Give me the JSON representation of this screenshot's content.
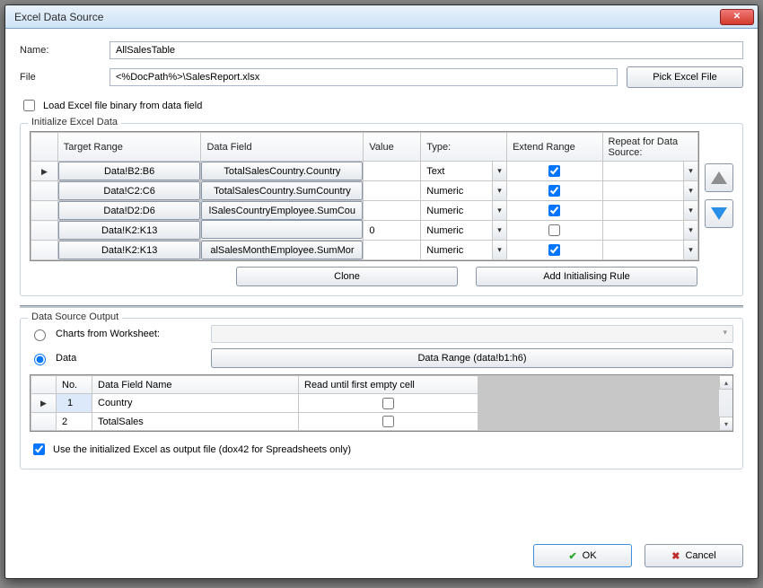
{
  "window": {
    "title": "Excel Data Source"
  },
  "form": {
    "name_label": "Name:",
    "name_value": "AllSalesTable",
    "file_label": "File",
    "file_value": "<%DocPath%>\\SalesReport.xlsx",
    "pick_file_label": "Pick Excel File",
    "load_binary_label": "Load Excel file binary from data field",
    "load_binary_checked": false
  },
  "init_group": {
    "title": "Initialize Excel Data",
    "headers": {
      "target_range": "Target Range",
      "data_field": "Data Field",
      "value": "Value",
      "type": "Type:",
      "extend_range": "Extend Range",
      "repeat": "Repeat for Data Source:"
    },
    "rows": [
      {
        "target": "Data!B2:B6",
        "field": "TotalSalesCountry.Country",
        "value": "",
        "type": "Text",
        "extend": true
      },
      {
        "target": "Data!C2:C6",
        "field": "TotalSalesCountry.SumCountry",
        "value": "",
        "type": "Numeric",
        "extend": true
      },
      {
        "target": "Data!D2:D6",
        "field": "lSalesCountryEmployee.SumCou",
        "value": "",
        "type": "Numeric",
        "extend": true
      },
      {
        "target": "Data!K2:K13",
        "field": "",
        "value": "0",
        "type": "Numeric",
        "extend": false
      },
      {
        "target": "Data!K2:K13",
        "field": "alSalesMonthEmployee.SumMor",
        "value": "",
        "type": "Numeric",
        "extend": true
      }
    ],
    "active_row": 0,
    "clone_label": "Clone",
    "add_rule_label": "Add Initialising Rule"
  },
  "output_group": {
    "title": "Data Source Output",
    "charts_label": "Charts from Worksheet:",
    "data_label": "Data",
    "selected": "data",
    "data_range_btn": "Data Range (data!b1:h6)",
    "headers": {
      "no": "No.",
      "field": "Data Field Name",
      "read_until": "Read until first empty cell"
    },
    "rows": [
      {
        "no": "1",
        "field": "Country",
        "read_until": false
      },
      {
        "no": "2",
        "field": "TotalSales",
        "read_until": false
      }
    ],
    "active_row": 0,
    "use_output_label": "Use the initialized Excel as output file (dox42 for Spreadsheets only)",
    "use_output_checked": true
  },
  "footer": {
    "ok": "OK",
    "cancel": "Cancel"
  }
}
